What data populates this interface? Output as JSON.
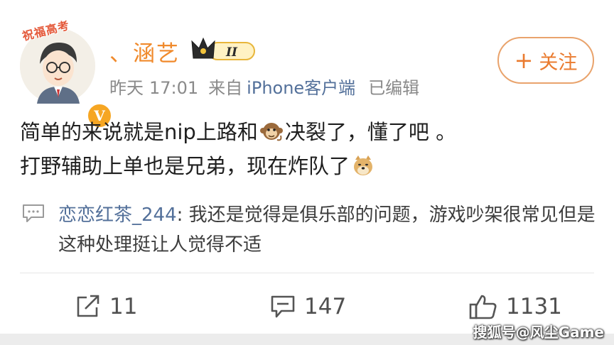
{
  "post": {
    "author": {
      "avatar_tag": "祝福高考",
      "name": "、涵艺",
      "verified_mark": "V",
      "rank_badge": "II"
    },
    "meta": {
      "day": "昨天",
      "time": "17:01",
      "from_label": "来自",
      "client": "iPhone客户端",
      "edited": "已编辑"
    },
    "follow_button": {
      "plus": "+",
      "label": "关注"
    },
    "text_line1_a": "简单的来说就是nip上路和",
    "text_line1_b": "决裂了，懂了吧 。",
    "text_line2": "打野辅助上单也是兄弟，现在炸队了",
    "emojis": [
      "monkey-emoji",
      "doge-emoji"
    ]
  },
  "comment": {
    "username": "恋恋红茶_244",
    "separator": ": ",
    "text": "我还是觉得是俱乐部的问题，游戏吵架很常见但是这种处理挺让人觉得不适"
  },
  "actions": {
    "share_count": "11",
    "comment_count": "147",
    "like_count": "1131"
  },
  "watermark": "搜狐号@风尘Game",
  "colors": {
    "username": "#f08a2c",
    "link": "#53709a",
    "meta": "#8a8a8a",
    "follow": "#ea7b2f"
  }
}
